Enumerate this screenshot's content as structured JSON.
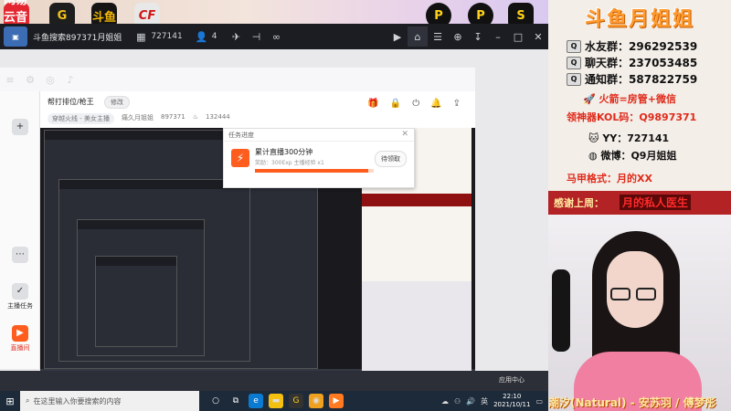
{
  "desktop_icons": [
    "网易云音乐",
    "G",
    "斗鱼",
    "CF",
    "P",
    "P",
    "S"
  ],
  "player": {
    "title": "斗鱼搜索897371月姐姐",
    "viewers": "727141",
    "members": "4"
  },
  "client": {
    "stream_title": "帮打排位/枪王",
    "edit_label": "修改",
    "category": "穿越火线 - 美女主播",
    "streamer_name": "痛久月姐姐",
    "room_id": "897371",
    "hot": "132444",
    "sidebar": [
      {
        "label": "主播任务"
      },
      {
        "label": "直播间"
      }
    ]
  },
  "task_popup": {
    "header": "任务进度",
    "name": "累计直播300分钟",
    "reward": "奖励：300Exp 主播经验 x1",
    "button": "待领取",
    "progress": 0.95
  },
  "taskbar": {
    "search_placeholder": "在这里输入你要搜索的内容",
    "time": "22:10",
    "date": "2021/10/11",
    "app_center": "应用中心"
  },
  "promo": {
    "title": "斗鱼月姐姐",
    "groups": [
      {
        "label": "水友群：",
        "number": "296292539"
      },
      {
        "label": "聊天群：",
        "number": "237053485"
      },
      {
        "label": "通知群：",
        "number": "587822759"
      }
    ],
    "rocket_line": "火箭=房管+微信",
    "kol_line": "领神器KOL码：Q9897371",
    "yy_line": "YY：727141",
    "weibo_line": "微博：Q9月姐姐",
    "vest_line": "马甲格式：月的XX",
    "thanks_label": "感谢上周：",
    "thanks_value": "月的私人医生"
  },
  "caption": "潮汐(Natural) - 安苏羽 / 傅梦彤",
  "colors": {
    "accent": "#ff5d1d",
    "promo_title": "#ff9a2e",
    "thanks_bar": "#b32225"
  }
}
